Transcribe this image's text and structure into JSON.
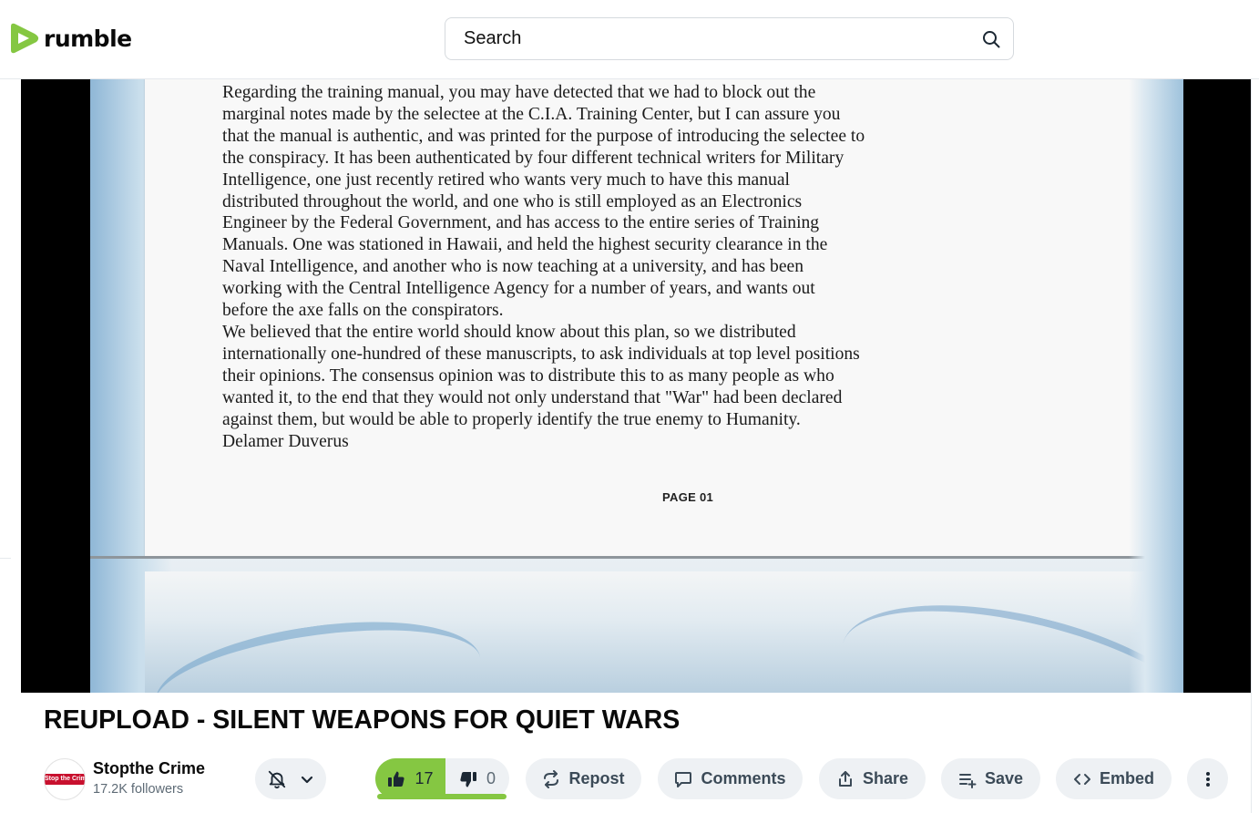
{
  "header": {
    "logo_text": "rumble",
    "search_placeholder": "Search",
    "brand_color": "#85c742"
  },
  "video": {
    "document_lines": [
      "Regarding the training manual, you may have detected that we had to block out the",
      "marginal notes made by the selectee at the C.I.A. Training Center, but I can assure you",
      "that the manual is authentic, and was printed for the purpose of introducing the selectee to",
      "the conspiracy. It has been authenticated by four different technical writers for Military",
      "Intelligence, one just recently retired who wants very much to have this manual",
      "distributed throughout the world, and one who is still employed as an Electronics",
      "Engineer by the Federal Government, and has access to the entire series of Training",
      "Manuals. One was stationed in Hawaii, and held the highest security clearance in the",
      "Naval Intelligence, and another who is now teaching at a university, and has been",
      "working with the Central Intelligence Agency for a number of years, and wants out",
      "before the axe falls on the conspirators.",
      "We believed that the entire world should know about this plan, so we distributed",
      "internationally one-hundred of these manuscripts, to ask individuals at top level positions",
      "their opinions. The consensus opinion was to distribute this to as many people as who",
      "wanted it, to the end that they would not only understand that \"War\" had been declared",
      "against them, but would be able to properly identify the true enemy to Humanity.",
      "Delamer Duverus"
    ],
    "page_label": "PAGE 01"
  },
  "title": "REUPLOAD - SILENT WEAPONS FOR QUIET WARS",
  "channel": {
    "name": "Stopthe Crime",
    "followers": "17.2K followers",
    "avatar_text": "Stop the Crime"
  },
  "votes": {
    "likes": "17",
    "dislikes": "0",
    "like_ratio": 1.0
  },
  "actions": {
    "repost": "Repost",
    "comments": "Comments",
    "share": "Share",
    "save": "Save",
    "embed": "Embed"
  },
  "icons": {
    "search": "search-icon",
    "notify": "bell-off-icon",
    "dropdown": "chevron-down-icon",
    "like": "thumbs-up-icon",
    "dislike": "thumbs-down-icon",
    "repost": "repost-icon",
    "comments": "comment-icon",
    "share": "share-icon",
    "save": "playlist-add-icon",
    "embed": "code-icon",
    "more": "more-vertical-icon"
  }
}
